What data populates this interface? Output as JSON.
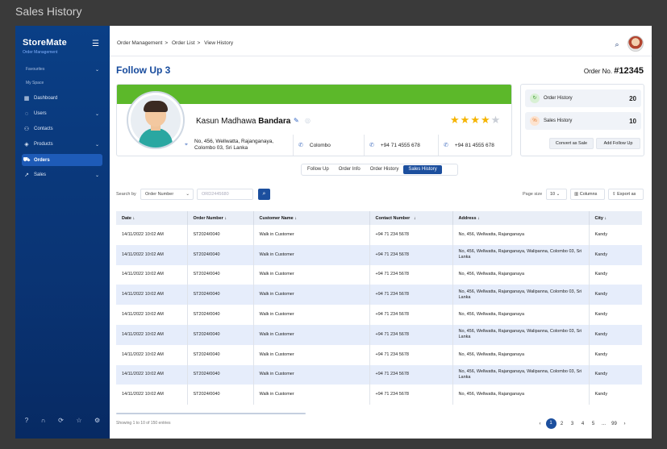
{
  "frame_title": "Sales History",
  "sidebar": {
    "logo": "StoreMate",
    "logo_sub": "Order Management",
    "favourites_label": "Favourites",
    "myspace_label": "My Space",
    "items": [
      {
        "label": "Dashboard",
        "icon": "dashboard-icon"
      },
      {
        "label": "Users",
        "icon": "users-icon"
      },
      {
        "label": "Contacts",
        "icon": "contacts-icon"
      },
      {
        "label": "Products",
        "icon": "products-icon"
      },
      {
        "label": "Orders",
        "icon": "orders-icon"
      },
      {
        "label": "Sales",
        "icon": "sales-icon"
      }
    ]
  },
  "breadcrumb": [
    "Order Management",
    "Order List",
    "View History"
  ],
  "page": {
    "title": "Follow Up 3",
    "order_no_label": "Order No.",
    "order_no": "#12345"
  },
  "customer": {
    "first_name": "Kasun Madhawa",
    "last_name": "Bandara",
    "rating": 4,
    "rating_max": 5,
    "address": "No, 456, Wellwatta, Rajanganaya, Colombo 03, Sri Lanka",
    "city": "Colombo",
    "phone1": "+94 71 4555 678",
    "phone2": "+94 81 4555 678"
  },
  "side_card": {
    "order_history_label": "Order History",
    "order_history_count": "20",
    "sales_history_label": "Sales History",
    "sales_history_count": "10",
    "convert_button": "Convert as Sale",
    "followup_button": "Add Follow Up"
  },
  "tabs": [
    "Follow Up",
    "Order Info",
    "Order History",
    "Sales History"
  ],
  "active_tab": "Sales History",
  "filter": {
    "search_by_label": "Search by",
    "search_by_value": "Order Number",
    "search_placeholder": "ORD2445680",
    "page_size_label": "Page size",
    "page_size_value": "10",
    "columns_label": "Columns",
    "export_label": "Export as"
  },
  "table": {
    "columns": [
      "Date",
      "Order Number",
      "Customer Name",
      "Contact Number",
      "Address",
      "City"
    ],
    "rows": [
      [
        "14/11/2022 10:02 AM",
        "ST2024/0040",
        "Walk in Customer",
        "+94 71 234 5678",
        "No, 456, Wellwatta, Rajanganaya",
        "Kandy"
      ],
      [
        "14/11/2022 10:02 AM",
        "ST2024/0040",
        "Walk in Customer",
        "+94 71 234 5678",
        "No, 456, Wellwatta, Rajanganaya, Walipanna, Colombo 03, Sri Lanka",
        "Kandy"
      ],
      [
        "14/11/2022 10:02 AM",
        "ST2024/0040",
        "Walk in Customer",
        "+94 71 234 5678",
        "No, 456, Wellwatta, Rajanganaya",
        "Kandy"
      ],
      [
        "14/11/2022 10:02 AM",
        "ST2024/0040",
        "Walk in Customer",
        "+94 71 234 5678",
        "No, 456, Wellwatta, Rajanganaya, Walipanna, Colombo 03, Sri Lanka",
        "Kandy"
      ],
      [
        "14/11/2022 10:02 AM",
        "ST2024/0040",
        "Walk in Customer",
        "+94 71 234 5678",
        "No, 456, Wellwatta, Rajanganaya",
        "Kandy"
      ],
      [
        "14/11/2022 10:02 AM",
        "ST2024/0040",
        "Walk in Customer",
        "+94 71 234 5678",
        "No, 456, Wellwatta, Rajanganaya, Walipanna, Colombo 03, Sri Lanka",
        "Kandy"
      ],
      [
        "14/11/2022 10:02 AM",
        "ST2024/0040",
        "Walk in Customer",
        "+94 71 234 5678",
        "No, 456, Wellwatta, Rajanganaya",
        "Kandy"
      ],
      [
        "14/11/2022 10:02 AM",
        "ST2024/0040",
        "Walk in Customer",
        "+94 71 234 5678",
        "No, 456, Wellwatta, Rajanganaya, Walipanna, Colombo 03, Sri Lanka",
        "Kandy"
      ],
      [
        "14/11/2022 10:02 AM",
        "ST2024/0040",
        "Walk in Customer",
        "+94 71 234 5678",
        "No, 456, Wellwatta, Rajanganaya",
        "Kandy"
      ]
    ]
  },
  "footer": {
    "info": "Showing 1 to 10 of 150 entries",
    "pages": [
      "1",
      "2",
      "3",
      "4",
      "5",
      "...",
      "99"
    ],
    "current_page": "1"
  },
  "colors": {
    "primary": "#1c4f9e",
    "band": "#5cb82a",
    "star": "#f5b400",
    "row_alt": "#e6edfb"
  }
}
